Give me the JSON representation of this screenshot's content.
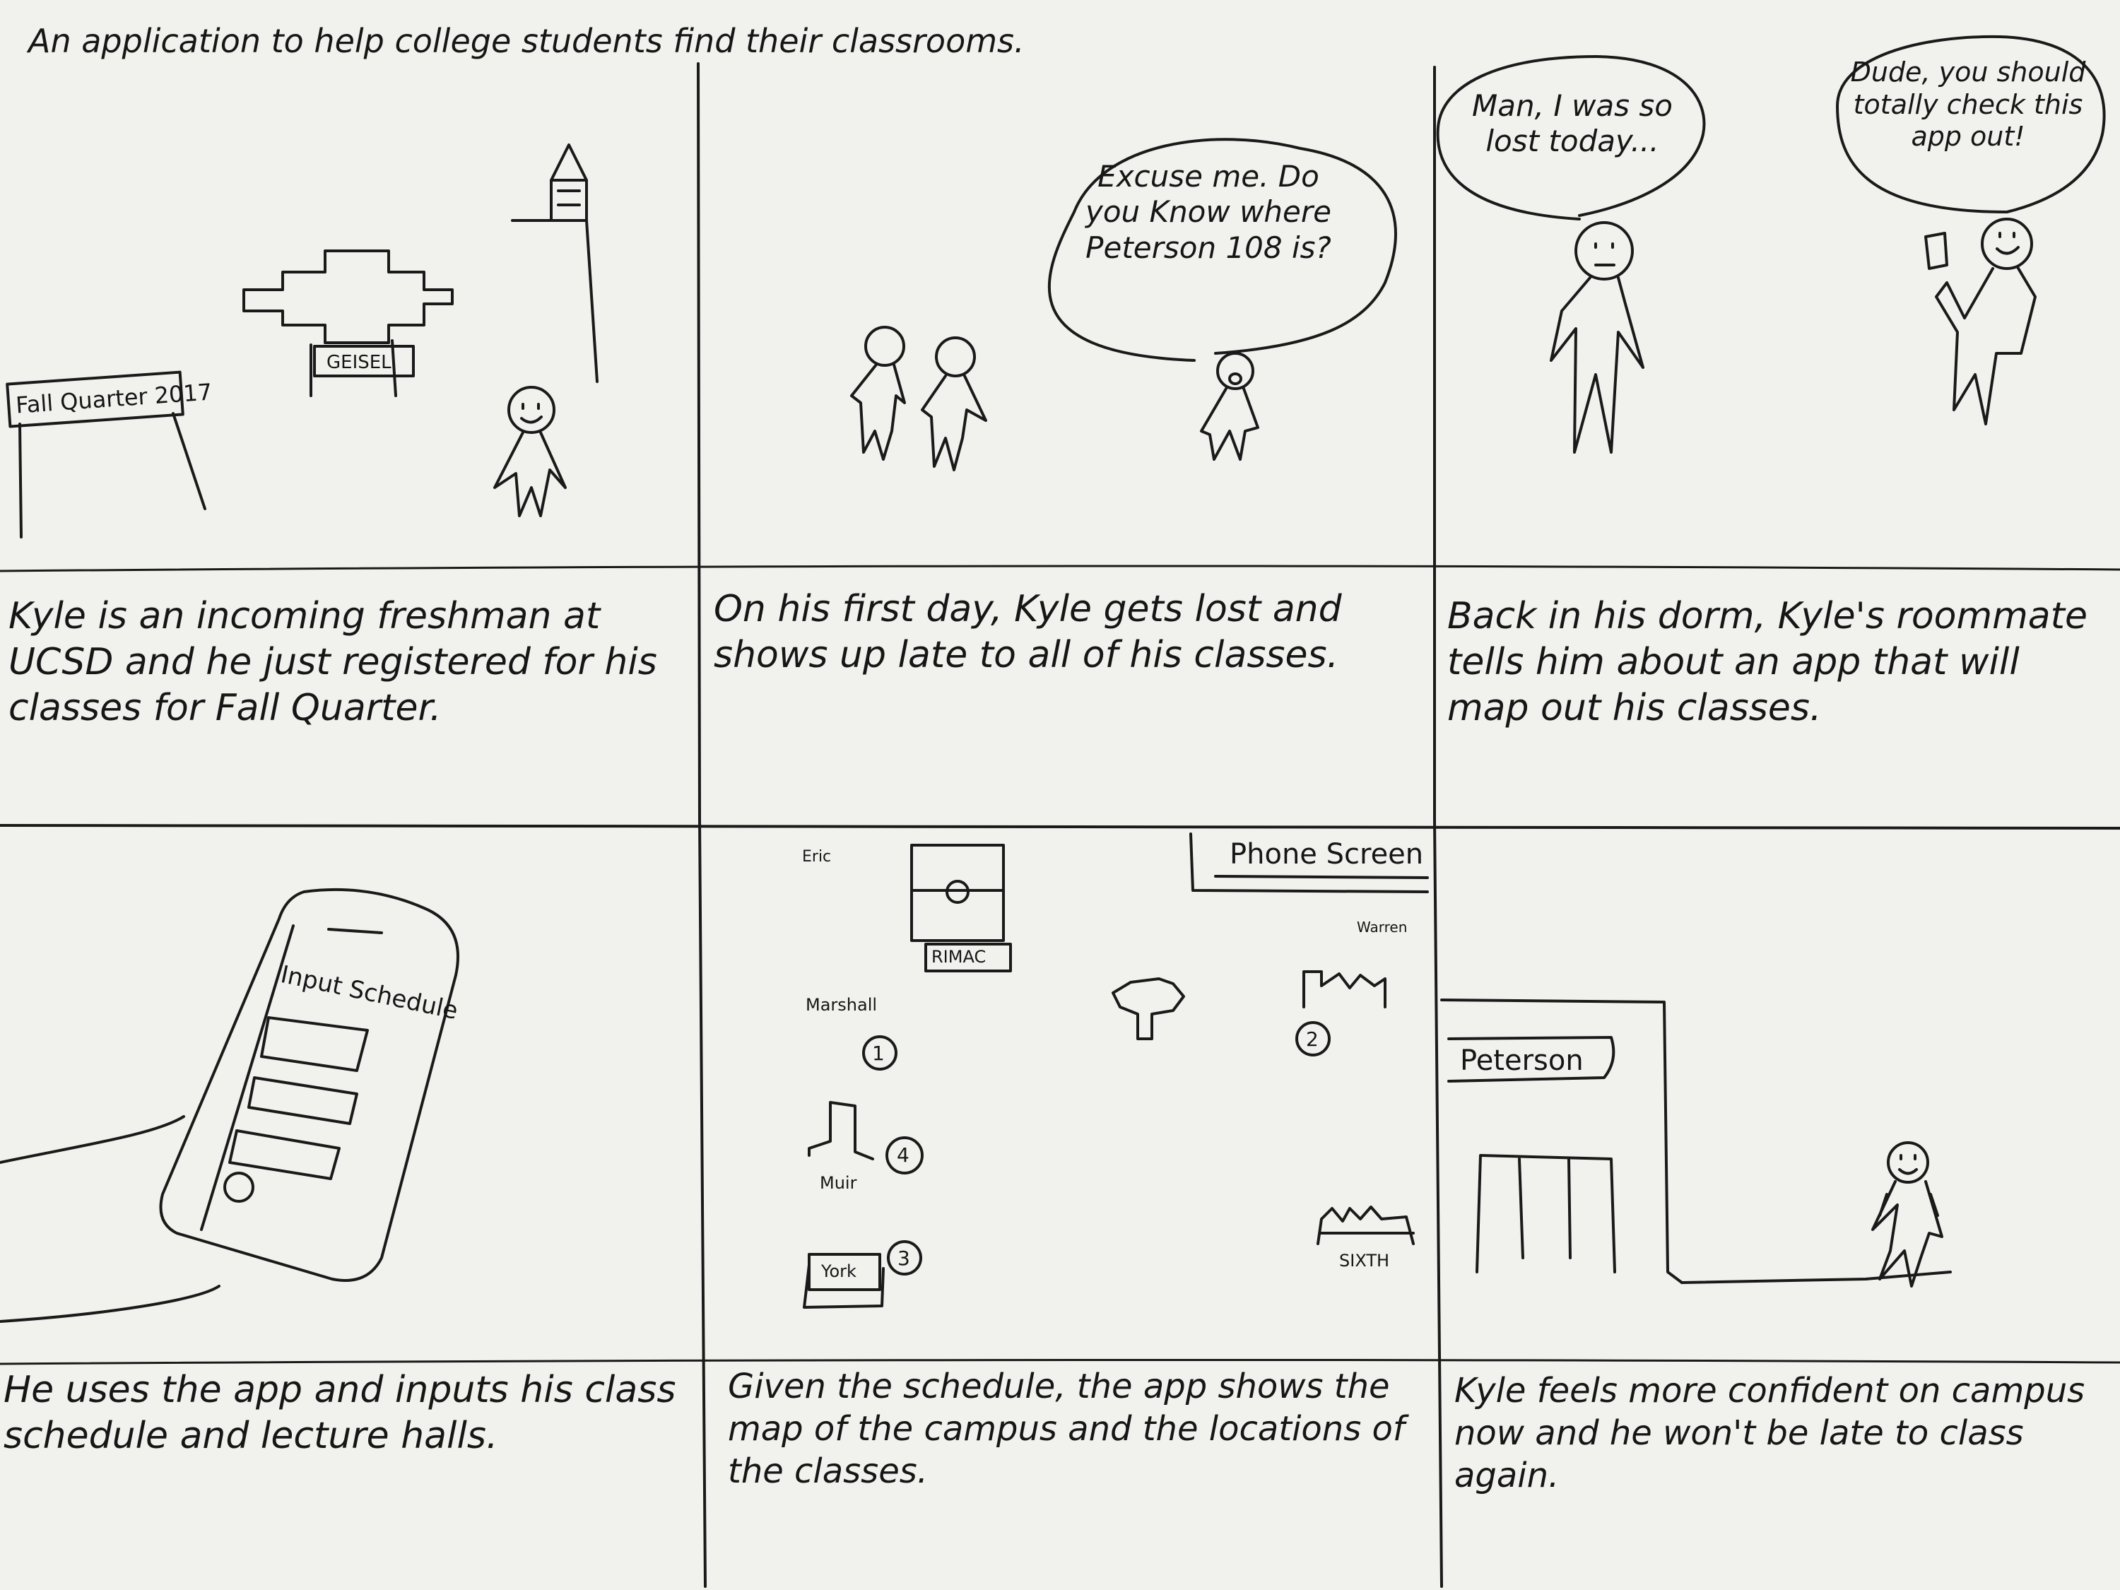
{
  "title": "An application to help college students find their classrooms.",
  "panels": [
    {
      "caption": "Kyle is an incoming freshman at UCSD and he just registered for his classes for Fall Quarter.",
      "labels": {
        "banner": "Fall Quarter 2017",
        "library": "GEISEL"
      }
    },
    {
      "caption": "On his first day, Kyle gets lost and shows up late to all of his classes.",
      "bubble": "Excuse me. Do you Know where Peterson 108 is?"
    },
    {
      "caption": "Back in his dorm, Kyle's roommate tells him about an app that will map out his classes.",
      "bubble_left": "Man, I was so lost today...",
      "bubble_right": "Dude, you should totally check this app out!"
    },
    {
      "caption": "He uses the app and inputs his class schedule and lecture halls.",
      "labels": {
        "screen_title": "Input Schedule"
      }
    },
    {
      "caption": "Given the schedule, the app shows the map of the campus and the locations of the classes.",
      "labels": {
        "phone_screen": "Phone Screen",
        "eric": "Eric",
        "rimac": "RIMAC",
        "warren": "Warren",
        "marshall": "Marshall",
        "muir": "Muir",
        "york": "York",
        "sixth": "SIXTH",
        "markers": [
          "1",
          "2",
          "3",
          "4"
        ]
      }
    },
    {
      "caption": "Kyle feels more confident on campus now and he won't be late to class again.",
      "labels": {
        "building": "Peterson"
      }
    }
  ],
  "colors": {
    "paper": "#f1f1ee",
    "ink": "#1a1a1a"
  }
}
